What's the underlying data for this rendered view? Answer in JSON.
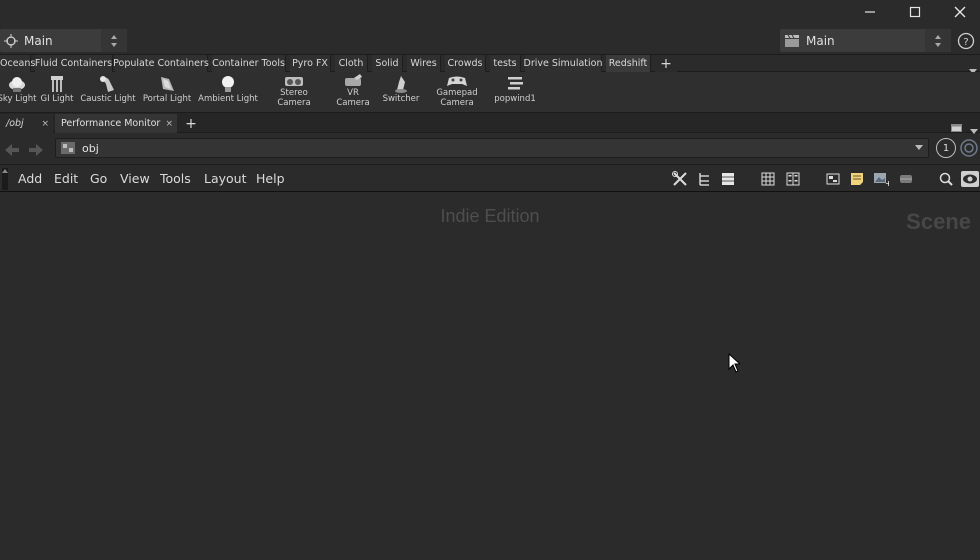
{
  "desktop": {
    "left_label": "Main",
    "right_label": "Main"
  },
  "shelf_tabs": [
    {
      "label": "Oceans"
    },
    {
      "label": "Fluid Containers"
    },
    {
      "label": "Populate Containers"
    },
    {
      "label": "Container Tools"
    },
    {
      "label": "Pyro FX"
    },
    {
      "label": "Cloth"
    },
    {
      "label": "Solid"
    },
    {
      "label": "Wires"
    },
    {
      "label": "Crowds"
    },
    {
      "label": "tests"
    },
    {
      "label": "Drive Simulation"
    },
    {
      "label": "Redshift"
    }
  ],
  "shelf_add_label": "+",
  "shelf_tools": [
    {
      "label": "Sky Light",
      "icon": "sky-light-icon"
    },
    {
      "label": "GI Light",
      "icon": "gi-light-icon"
    },
    {
      "label": "Caustic Light",
      "icon": "caustic-light-icon"
    },
    {
      "label": "Portal Light",
      "icon": "portal-light-icon"
    },
    {
      "label": "Ambient Light",
      "icon": "ambient-light-icon"
    },
    {
      "label": "Stereo\nCamera",
      "line1": "Stereo",
      "line2": "Camera",
      "icon": "stereo-camera-icon"
    },
    {
      "label": "VR\nCamera",
      "line1": "VR",
      "line2": "Camera",
      "icon": "vr-camera-icon"
    },
    {
      "label": "Switcher",
      "icon": "switcher-icon"
    },
    {
      "label": "Gamepad\nCamera",
      "line1": "Gamepad",
      "line2": "Camera",
      "icon": "gamepad-camera-icon"
    },
    {
      "label": "popwind1",
      "icon": "popwind-icon"
    }
  ],
  "pane_tabs": [
    {
      "label": "/obj"
    },
    {
      "label": "Performance Monitor"
    }
  ],
  "pane_close": "×",
  "pane_add_label": "+",
  "path": {
    "value": "obj"
  },
  "path_badge": "1",
  "menus": [
    "Add",
    "Edit",
    "Go",
    "View",
    "Tools",
    "Layout",
    "Help"
  ],
  "network": {
    "watermark": "Indie Edition",
    "context_label": "Scene"
  },
  "colors": {
    "background": "#2b2b2b",
    "panel": "#3c3c3c",
    "text": "#cfcfcf"
  }
}
